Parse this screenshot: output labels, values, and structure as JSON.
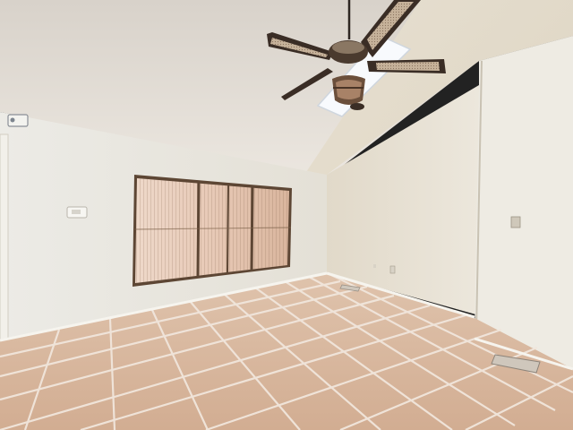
{
  "scene": {
    "description_kind": "empty-room-photo",
    "watermark_text": "",
    "colors": {
      "ceiling": "#e2ddd6",
      "wall_left": "#ebe8e0",
      "wall_right": "#e6e1d6",
      "wall_far": "#e4ded0",
      "floor_tile": "#d7b79c",
      "grout": "#f1e9e0",
      "blind_wood": "#6e5640",
      "blind_glow": "#e9d2c3",
      "fan_blade": "#3b2f28",
      "skylight": "#f7f9fc"
    },
    "icons": [
      "ceiling-fan-icon",
      "skylight",
      "window-with-blinds",
      "thermostat-icon",
      "smoke-detector-icon",
      "light-switch-icon",
      "floor-vent-icon",
      "wall-outlet-icon"
    ]
  }
}
